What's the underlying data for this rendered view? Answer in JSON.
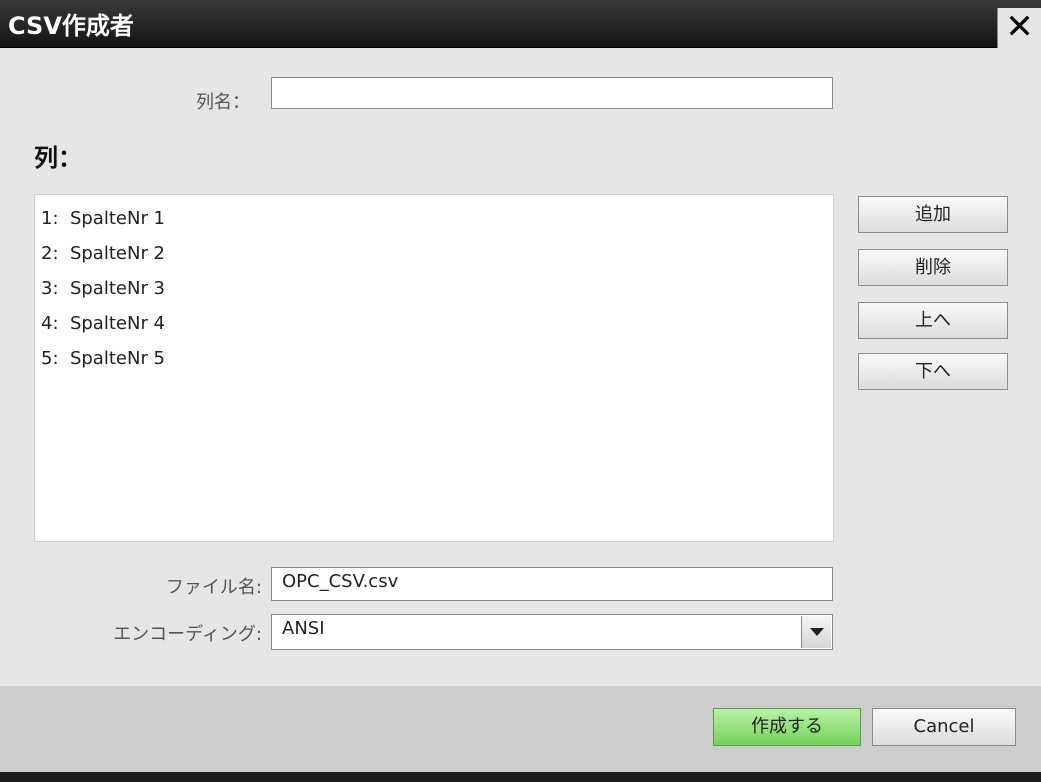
{
  "window": {
    "title": "CSV作成者",
    "close_icon": "close-icon"
  },
  "column_name": {
    "label": "列名：",
    "value": ""
  },
  "columns_heading": "列：",
  "columns": [
    "1:  SpalteNr 1",
    "2:  SpalteNr 2",
    "3:  SpalteNr 3",
    "4:  SpalteNr 4",
    "5:  SpalteNr 5"
  ],
  "side_buttons": {
    "add": "追加",
    "delete": "削除",
    "up": "上へ",
    "down": "下へ"
  },
  "file_name": {
    "label": "ファイル名:",
    "value": "OPC_CSV.csv"
  },
  "encoding": {
    "label": "エンコーディング:",
    "value": "ANSI"
  },
  "footer": {
    "create_label": "作成する",
    "cancel_label": "Cancel"
  },
  "colors": {
    "titlebar": "#1f1f1f",
    "dialog_bg": "#e6e6e6",
    "footer_bg": "#cdcdcd",
    "create_button": "#8fdc72"
  }
}
